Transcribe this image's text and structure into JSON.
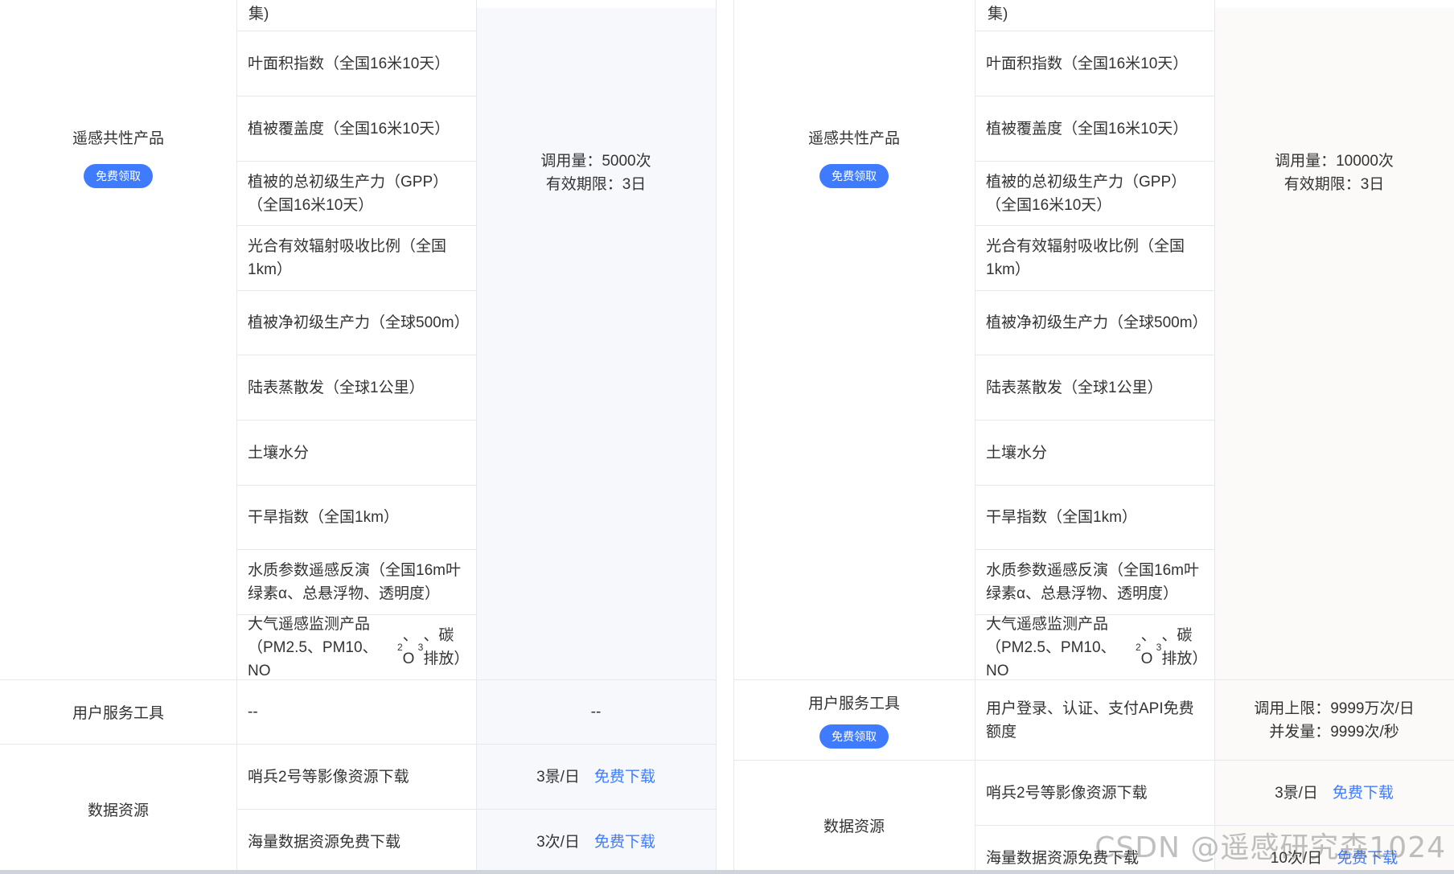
{
  "accent_color": "#3e7bff",
  "left": {
    "top_fragment": "集)",
    "remote_sensing": {
      "category": "遥感共性产品",
      "claim_button": "免费领取",
      "features": [
        "叶面积指数（全国16米10天）",
        "植被覆盖度（全国16米10天）",
        "植被的总初级生产力（GPP）（全国16米10天）",
        "光合有效辐射吸收比例（全国1km）",
        "植被净初级生产力（全球500m）",
        "陆表蒸散发（全球1公里）",
        "土壤水分",
        "干旱指数（全国1km）",
        "水质参数遥感反演（全国16m叶绿素α、总悬浮物、透明度）",
        "大气遥感监测产品（PM2.5、PM10、NO₂、O₃、碳排放）"
      ],
      "quota_line1": "调用量：5000次",
      "quota_line2": "有效期限：3日"
    },
    "user_tools": {
      "category": "用户服务工具",
      "feature": "--",
      "quota": "--"
    },
    "data_resources": {
      "category": "数据资源",
      "rows": [
        {
          "feature": "哨兵2号等影像资源下载",
          "quota": "3景/日",
          "link": "免费下载"
        },
        {
          "feature": "海量数据资源免费下载",
          "quota": "3次/日",
          "link": "免费下载"
        }
      ]
    }
  },
  "right": {
    "top_fragment": "集)",
    "remote_sensing": {
      "category": "遥感共性产品",
      "claim_button": "免费领取",
      "features": [
        "叶面积指数（全国16米10天）",
        "植被覆盖度（全国16米10天）",
        "植被的总初级生产力（GPP）（全国16米10天）",
        "光合有效辐射吸收比例（全国1km）",
        "植被净初级生产力（全球500m）",
        "陆表蒸散发（全球1公里）",
        "土壤水分",
        "干旱指数（全国1km）",
        "水质参数遥感反演（全国16m叶绿素α、总悬浮物、透明度）",
        "大气遥感监测产品（PM2.5、PM10、NO₂、O₃、碳排放）"
      ],
      "quota_line1": "调用量：10000次",
      "quota_line2": "有效期限：3日"
    },
    "user_tools": {
      "category": "用户服务工具",
      "claim_button": "免费领取",
      "feature": "用户登录、认证、支付API免费额度",
      "quota_line1": "调用上限：9999万次/日",
      "quota_line2": "并发量：9999次/秒"
    },
    "data_resources": {
      "category": "数据资源",
      "rows": [
        {
          "feature": "哨兵2号等影像资源下载",
          "quota": "3景/日",
          "link": "免费下载"
        },
        {
          "feature": "海量数据资源免费下载",
          "quota": "10次/日",
          "link": "免费下载"
        }
      ]
    }
  },
  "watermark": "CSDN @遥感研究森1024"
}
